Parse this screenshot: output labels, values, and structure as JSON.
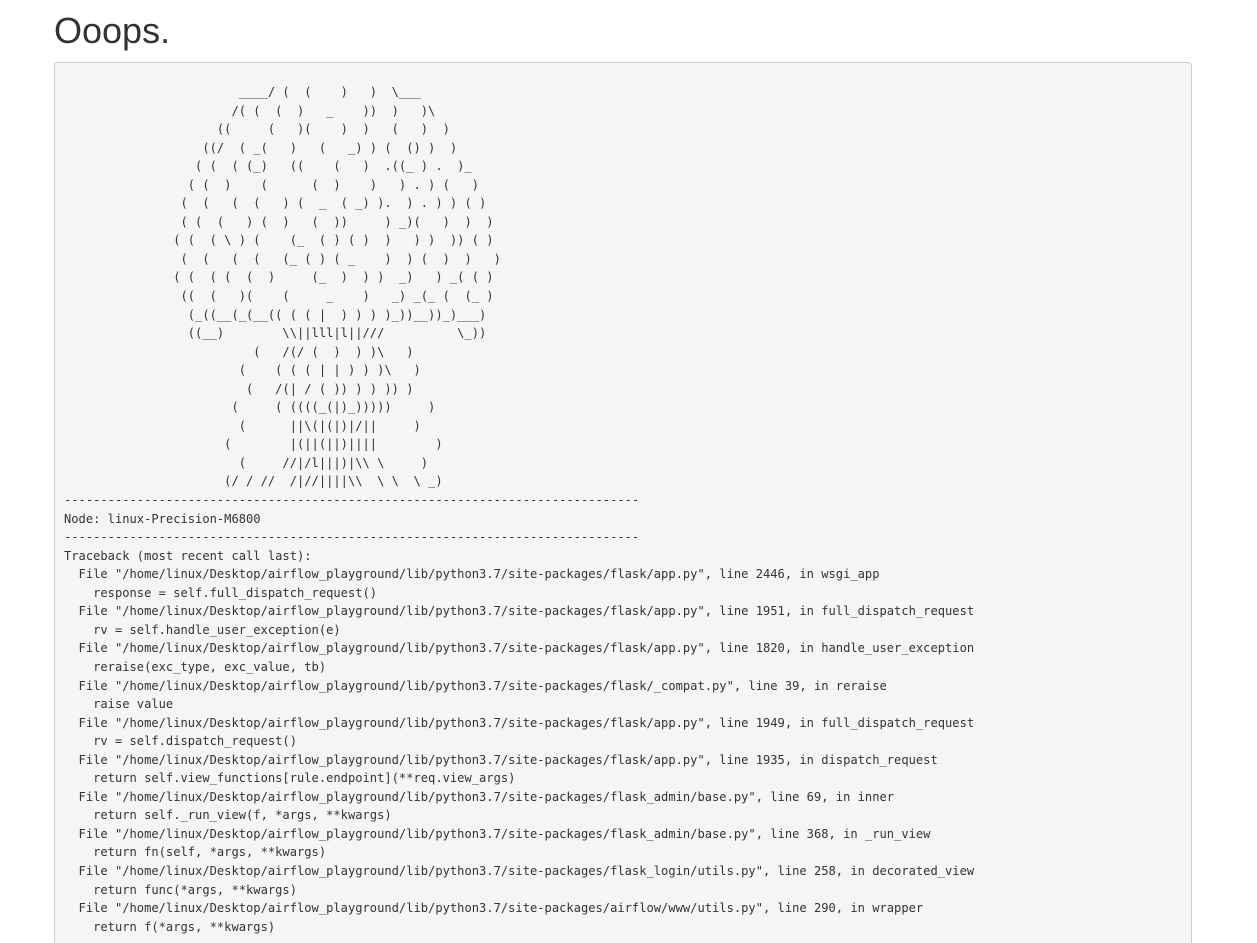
{
  "page": {
    "title": "Ooops."
  },
  "error": {
    "text": "                        ____/ (  (    )   )  \\___\n                       /( (  (  )   _    ))  )   )\\\n                     ((     (   )(    )  )   (   )  )\n                   ((/  ( _(   )   (   _) ) (  () )  )\n                  ( (  ( (_)   ((    (   )  .((_ ) .  )_\n                 ( (  )    (      (  )    )   ) . ) (   )\n                (  (   (  (   ) (  _  ( _) ).  ) . ) ) ( )\n                ( (  (   ) (  )   (  ))     ) _)(   )  )  )\n               ( (  ( \\ ) (    (_  ( ) ( )  )   ) )  )) ( )\n                (  (   (  (   (_ ( ) ( _    )  ) (  )  )   )\n               ( (  ( (  (  )     (_  )  ) )  _)   ) _( ( )\n                ((  (   )(    (     _    )   _) _(_ (  (_ )\n                 (_((__(_(__(( ( ( |  ) ) ) )_))__))_)___)\n                 ((__)        \\\\||lll|l||///          \\_))\n                          (   /(/ (  )  ) )\\   )\n                        (    ( ( ( | | ) ) )\\   )\n                         (   /(| / ( )) ) ) )) )\n                       (     ( ((((_(|)_)))))     )\n                        (      ||\\(|(|)|/||     )\n                      (        |(||(||)||||        )\n                        (     //|/l|||)|\\\\ \\     )\n                      (/ / //  /|//||||\\\\  \\ \\  \\ _)\n-------------------------------------------------------------------------------\nNode: linux-Precision-M6800\n-------------------------------------------------------------------------------\nTraceback (most recent call last):\n  File \"/home/linux/Desktop/airflow_playground/lib/python3.7/site-packages/flask/app.py\", line 2446, in wsgi_app\n    response = self.full_dispatch_request()\n  File \"/home/linux/Desktop/airflow_playground/lib/python3.7/site-packages/flask/app.py\", line 1951, in full_dispatch_request\n    rv = self.handle_user_exception(e)\n  File \"/home/linux/Desktop/airflow_playground/lib/python3.7/site-packages/flask/app.py\", line 1820, in handle_user_exception\n    reraise(exc_type, exc_value, tb)\n  File \"/home/linux/Desktop/airflow_playground/lib/python3.7/site-packages/flask/_compat.py\", line 39, in reraise\n    raise value\n  File \"/home/linux/Desktop/airflow_playground/lib/python3.7/site-packages/flask/app.py\", line 1949, in full_dispatch_request\n    rv = self.dispatch_request()\n  File \"/home/linux/Desktop/airflow_playground/lib/python3.7/site-packages/flask/app.py\", line 1935, in dispatch_request\n    return self.view_functions[rule.endpoint](**req.view_args)\n  File \"/home/linux/Desktop/airflow_playground/lib/python3.7/site-packages/flask_admin/base.py\", line 69, in inner\n    return self._run_view(f, *args, **kwargs)\n  File \"/home/linux/Desktop/airflow_playground/lib/python3.7/site-packages/flask_admin/base.py\", line 368, in _run_view\n    return fn(self, *args, **kwargs)\n  File \"/home/linux/Desktop/airflow_playground/lib/python3.7/site-packages/flask_login/utils.py\", line 258, in decorated_view\n    return func(*args, **kwargs)\n  File \"/home/linux/Desktop/airflow_playground/lib/python3.7/site-packages/airflow/www/utils.py\", line 290, in wrapper\n    return f(*args, **kwargs)"
  },
  "colors": {
    "text": "#333333",
    "box_background": "#f5f5f5",
    "box_border": "#cccccc",
    "page_background": "#ffffff"
  }
}
